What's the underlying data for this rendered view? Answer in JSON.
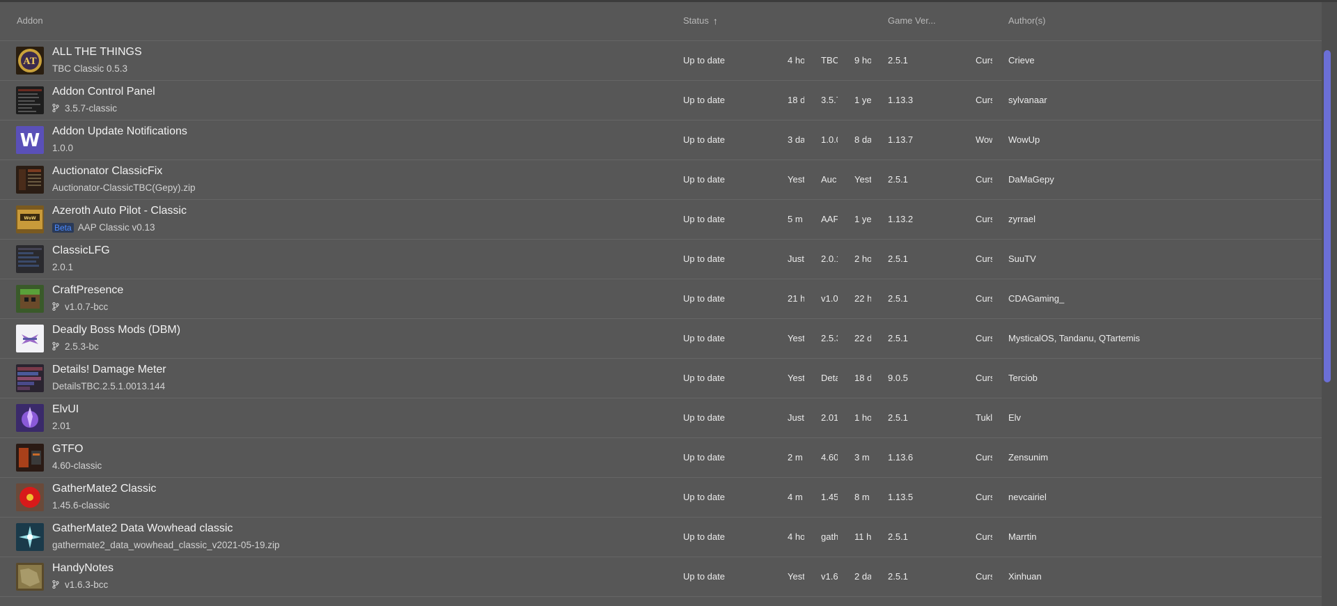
{
  "header": {
    "addon": "Addon",
    "status": "Status",
    "sort_icon": "arrow-up-icon",
    "game_version": "Game Ver...",
    "authors": "Author(s)"
  },
  "colors": {
    "background": "#575757",
    "scrollbar": "#6b6fd6",
    "beta_badge": "#4d8bff"
  },
  "rows": [
    {
      "name": "ALL THE THINGS",
      "sub": "TBC Classic 0.5.3",
      "branch": false,
      "beta": "",
      "status": "Up to date",
      "t1": "4 ho",
      "v1": "TBC",
      "t2": "9 ho",
      "game": "2.5.1",
      "prov": "Curs",
      "author": "Crieve",
      "thumb": "att"
    },
    {
      "name": "Addon Control Panel",
      "sub": "3.5.7-classic",
      "branch": true,
      "beta": "",
      "status": "Up to date",
      "t1": "18 d",
      "v1": "3.5.7",
      "t2": "1 ye",
      "game": "1.13.3",
      "prov": "Curs",
      "author": "sylvanaar",
      "thumb": "acp"
    },
    {
      "name": "Addon Update Notifications",
      "sub": "1.0.0",
      "branch": false,
      "beta": "",
      "status": "Up to date",
      "t1": "3 da",
      "v1": "1.0.0",
      "t2": "8 da",
      "game": "1.13.7",
      "prov": "Wow",
      "author": "WowUp",
      "thumb": "w"
    },
    {
      "name": "Auctionator ClassicFix",
      "sub": "Auctionator-ClassicTBC(Gepy).zip",
      "branch": false,
      "beta": "",
      "status": "Up to date",
      "t1": "Yest",
      "v1": "Auc",
      "t2": "Yest",
      "game": "2.5.1",
      "prov": "Curs",
      "author": "DaMaGepy",
      "thumb": "auc"
    },
    {
      "name": "Azeroth Auto Pilot - Classic",
      "sub": "AAP Classic v0.13",
      "branch": false,
      "beta": "Beta",
      "status": "Up to date",
      "t1": "5 m",
      "v1": "AAF",
      "t2": "1 ye",
      "game": "1.13.2",
      "prov": "Curs",
      "author": "zyrrael",
      "thumb": "aap"
    },
    {
      "name": "ClassicLFG",
      "sub": "2.0.1",
      "branch": false,
      "beta": "",
      "status": "Up to date",
      "t1": "Just",
      "v1": "2.0.1",
      "t2": "2 ho",
      "game": "2.5.1",
      "prov": "Curs",
      "author": "SuuTV",
      "thumb": "lfg"
    },
    {
      "name": "CraftPresence",
      "sub": "v1.0.7-bcc",
      "branch": true,
      "beta": "",
      "status": "Up to date",
      "t1": "21 h",
      "v1": "v1.0",
      "t2": "22 h",
      "game": "2.5.1",
      "prov": "Curs",
      "author": "CDAGaming_",
      "thumb": "craft"
    },
    {
      "name": "Deadly Boss Mods (DBM)",
      "sub": "2.5.3-bc",
      "branch": true,
      "beta": "",
      "status": "Up to date",
      "t1": "Yest",
      "v1": "2.5.3",
      "t2": "22 d",
      "game": "2.5.1",
      "prov": "Curs",
      "author": "MysticalOS, Tandanu, QTartemis",
      "thumb": "dbm"
    },
    {
      "name": "Details! Damage Meter",
      "sub": "DetailsTBC.2.5.1.0013.144",
      "branch": false,
      "beta": "",
      "status": "Up to date",
      "t1": "Yest",
      "v1": "Deta",
      "t2": "18 d",
      "game": "9.0.5",
      "prov": "Curs",
      "author": "Terciob",
      "thumb": "details"
    },
    {
      "name": "ElvUI",
      "sub": "2.01",
      "branch": false,
      "beta": "",
      "status": "Up to date",
      "t1": "Just",
      "v1": "2.01",
      "t2": "1 ho",
      "game": "2.5.1",
      "prov": "Tukl",
      "author": "Elv",
      "thumb": "elv"
    },
    {
      "name": "GTFO",
      "sub": "4.60-classic",
      "branch": false,
      "beta": "",
      "status": "Up to date",
      "t1": "2 m",
      "v1": "4.60",
      "t2": "3 m",
      "game": "1.13.6",
      "prov": "Curs",
      "author": "Zensunim",
      "thumb": "gtfo"
    },
    {
      "name": "GatherMate2 Classic",
      "sub": "1.45.6-classic",
      "branch": false,
      "beta": "",
      "status": "Up to date",
      "t1": "4 m",
      "v1": "1.45",
      "t2": "8 m",
      "game": "1.13.5",
      "prov": "Curs",
      "author": "nevcairiel",
      "thumb": "gm2"
    },
    {
      "name": "GatherMate2 Data Wowhead classic",
      "sub": "gathermate2_data_wowhead_classic_v2021-05-19.zip",
      "branch": false,
      "beta": "",
      "status": "Up to date",
      "t1": "4 ho",
      "v1": "gath",
      "t2": "11 h",
      "game": "2.5.1",
      "prov": "Curs",
      "author": "Marrtin",
      "thumb": "gmdata"
    },
    {
      "name": "HandyNotes",
      "sub": "v1.6.3-bcc",
      "branch": true,
      "beta": "",
      "status": "Up to date",
      "t1": "Yest",
      "v1": "v1.6",
      "t2": "2 da",
      "game": "2.5.1",
      "prov": "Curs",
      "author": "Xinhuan",
      "thumb": "handy"
    }
  ]
}
